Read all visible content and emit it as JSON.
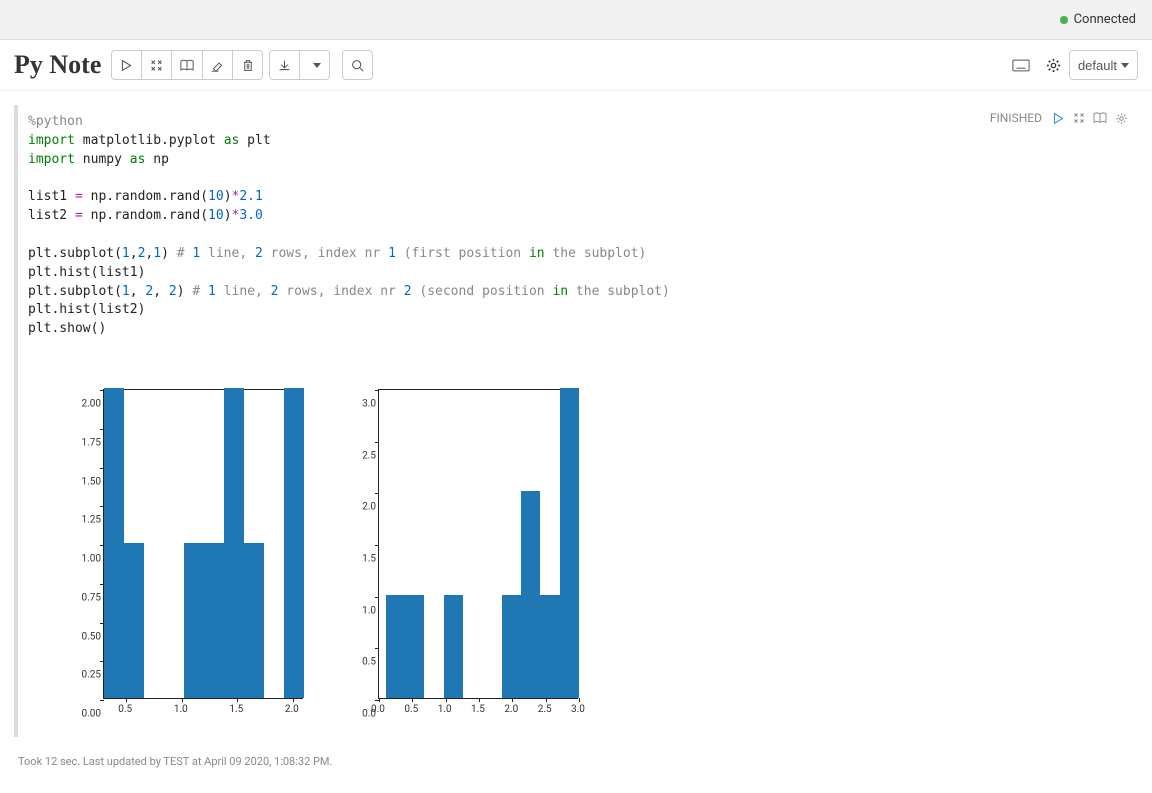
{
  "topbar": {
    "status_label": "Connected"
  },
  "header": {
    "title": "Py Note",
    "interpreter_select": "default"
  },
  "cell": {
    "status": "FINISHED",
    "footer": "Took 12 sec. Last updated by TEST at April 09 2020, 1:08:32 PM.",
    "code_lines": [
      {
        "raw": "%python",
        "tokens": [
          [
            "magic",
            "%python"
          ]
        ]
      },
      {
        "raw": "import matplotlib.pyplot as plt",
        "tokens": [
          [
            "keyword",
            "import"
          ],
          [
            "",
            " matplotlib.pyplot "
          ],
          [
            "keyword",
            "as"
          ],
          [
            "",
            " plt"
          ]
        ]
      },
      {
        "raw": "import numpy as np",
        "tokens": [
          [
            "keyword",
            "import"
          ],
          [
            "",
            " numpy "
          ],
          [
            "keyword",
            "as"
          ],
          [
            "",
            " np"
          ]
        ]
      },
      {
        "raw": "",
        "tokens": []
      },
      {
        "raw": "list1 = np.random.rand(10)*2.1",
        "tokens": [
          [
            "",
            "list1 "
          ],
          [
            "op",
            "="
          ],
          [
            "",
            " np.random.rand("
          ],
          [
            "number",
            "10"
          ],
          [
            "",
            ")"
          ],
          [
            "op",
            "*"
          ],
          [
            "number",
            "2.1"
          ]
        ]
      },
      {
        "raw": "list2 = np.random.rand(10)*3.0",
        "tokens": [
          [
            "",
            "list2 "
          ],
          [
            "op",
            "="
          ],
          [
            "",
            " np.random.rand("
          ],
          [
            "number",
            "10"
          ],
          [
            "",
            ")"
          ],
          [
            "op",
            "*"
          ],
          [
            "number",
            "3.0"
          ]
        ]
      },
      {
        "raw": "",
        "tokens": []
      },
      {
        "raw": "plt.subplot(1,2,1) # 1 line, 2 rows, index nr 1 (first position in the subplot)",
        "tokens": [
          [
            "",
            "plt.subplot("
          ],
          [
            "number",
            "1"
          ],
          [
            "",
            ","
          ],
          [
            "number",
            "2"
          ],
          [
            "",
            ","
          ],
          [
            "number",
            "1"
          ],
          [
            "",
            ") "
          ],
          [
            "comment",
            "# "
          ],
          [
            "number",
            "1"
          ],
          [
            "comment",
            " line, "
          ],
          [
            "number",
            "2"
          ],
          [
            "comment",
            " rows, index nr "
          ],
          [
            "number",
            "1"
          ],
          [
            "comment",
            " (first position "
          ],
          [
            "keyword",
            "in"
          ],
          [
            "comment",
            " the subplot)"
          ]
        ]
      },
      {
        "raw": "plt.hist(list1)",
        "tokens": [
          [
            "",
            "plt.hist(list1)"
          ]
        ]
      },
      {
        "raw": "plt.subplot(1, 2, 2) # 1 line, 2 rows, index nr 2 (second position in the subplot)",
        "tokens": [
          [
            "",
            "plt.subplot("
          ],
          [
            "number",
            "1"
          ],
          [
            "",
            ", "
          ],
          [
            "number",
            "2"
          ],
          [
            "",
            ", "
          ],
          [
            "number",
            "2"
          ],
          [
            "",
            ") "
          ],
          [
            "comment",
            "# "
          ],
          [
            "number",
            "1"
          ],
          [
            "comment",
            " line, "
          ],
          [
            "number",
            "2"
          ],
          [
            "comment",
            " rows, index nr "
          ],
          [
            "number",
            "2"
          ],
          [
            "comment",
            " (second position "
          ],
          [
            "keyword",
            "in"
          ],
          [
            "comment",
            " the subplot)"
          ]
        ]
      },
      {
        "raw": "plt.hist(list2)",
        "tokens": [
          [
            "",
            "plt.hist(list2)"
          ]
        ]
      },
      {
        "raw": "plt.show()",
        "tokens": [
          [
            "",
            "plt.show()"
          ]
        ]
      }
    ]
  },
  "chart_data": [
    {
      "type": "bar",
      "subplot": "left",
      "title": "",
      "xlabel": "",
      "ylabel": "",
      "xlim": [
        0.3,
        2.1
      ],
      "ylim": [
        0.0,
        2.0
      ],
      "yticks": [
        0.0,
        0.25,
        0.5,
        0.75,
        1.0,
        1.25,
        1.5,
        1.75,
        2.0
      ],
      "ytick_labels": [
        "0.00",
        "0.25",
        "0.50",
        "0.75",
        "1.00",
        "1.25",
        "1.50",
        "1.75",
        "2.00"
      ],
      "xticks": [
        0.5,
        1.0,
        1.5,
        2.0
      ],
      "xtick_labels": [
        "0.5",
        "1.0",
        "1.5",
        "2.0"
      ],
      "bin_edges": [
        0.3,
        0.48,
        0.66,
        0.84,
        1.02,
        1.2,
        1.38,
        1.56,
        1.74,
        1.92,
        2.1
      ],
      "values": [
        2,
        1,
        0,
        0,
        1,
        1,
        2,
        1,
        0,
        2
      ]
    },
    {
      "type": "bar",
      "subplot": "right",
      "title": "",
      "xlabel": "",
      "ylabel": "",
      "xlim": [
        0.0,
        3.0
      ],
      "ylim": [
        0.0,
        3.0
      ],
      "yticks": [
        0.0,
        0.5,
        1.0,
        1.5,
        2.0,
        2.5,
        3.0
      ],
      "ytick_labels": [
        "0.0",
        "0.5",
        "1.0",
        "1.5",
        "2.0",
        "2.5",
        "3.0"
      ],
      "xticks": [
        0.0,
        0.5,
        1.0,
        1.5,
        2.0,
        2.5,
        3.0
      ],
      "xtick_labels": [
        "0.0",
        "0.5",
        "1.0",
        "1.5",
        "2.0",
        "2.5",
        "3.0"
      ],
      "bin_edges": [
        0.1,
        0.39,
        0.68,
        0.97,
        1.26,
        1.55,
        1.84,
        2.13,
        2.42,
        2.71,
        3.0
      ],
      "values": [
        1,
        1,
        0,
        1,
        0,
        0,
        1,
        2,
        1,
        3
      ]
    }
  ]
}
